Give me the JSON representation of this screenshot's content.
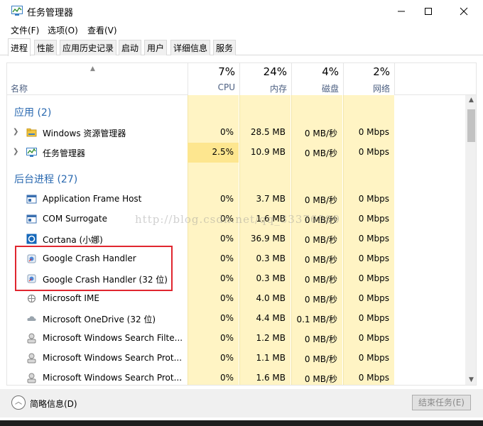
{
  "window": {
    "title": "任务管理器",
    "controls": {
      "minimize": "—",
      "maximize": "☐",
      "close": "✕"
    }
  },
  "menu": [
    "文件(F)",
    "选项(O)",
    "查看(V)"
  ],
  "tabs": [
    {
      "label": "进程",
      "active": true
    },
    {
      "label": "性能"
    },
    {
      "label": "应用历史记录"
    },
    {
      "label": "启动"
    },
    {
      "label": "用户"
    },
    {
      "label": "详细信息"
    },
    {
      "label": "服务"
    }
  ],
  "columns": {
    "name": "名称",
    "cpu": {
      "pct": "7%",
      "label": "CPU"
    },
    "mem": {
      "pct": "24%",
      "label": "内存"
    },
    "disk": {
      "pct": "4%",
      "label": "磁盘"
    },
    "net": {
      "pct": "2%",
      "label": "网络"
    }
  },
  "groups": {
    "apps": "应用 (2)",
    "background": "后台进程 (27)"
  },
  "apps": [
    {
      "name": "Windows 资源管理器",
      "cpu": "0%",
      "mem": "28.5 MB",
      "disk": "0 MB/秒",
      "net": "0 Mbps",
      "icon": "folder-icon"
    },
    {
      "name": "任务管理器",
      "cpu": "2.5%",
      "mem": "10.9 MB",
      "disk": "0 MB/秒",
      "net": "0 Mbps",
      "icon": "task-manager-icon"
    }
  ],
  "background": [
    {
      "name": "Application Frame Host",
      "cpu": "0%",
      "mem": "3.7 MB",
      "disk": "0 MB/秒",
      "net": "0 Mbps",
      "icon": "window-app-icon"
    },
    {
      "name": "COM Surrogate",
      "cpu": "0%",
      "mem": "1.6 MB",
      "disk": "0 MB/秒",
      "net": "0 Mbps",
      "icon": "window-app-icon"
    },
    {
      "name": "Cortana (小娜)",
      "cpu": "0%",
      "mem": "36.9 MB",
      "disk": "0 MB/秒",
      "net": "0 Mbps",
      "icon": "cortana-icon"
    },
    {
      "name": "Google Crash Handler",
      "cpu": "0%",
      "mem": "0.3 MB",
      "disk": "0 MB/秒",
      "net": "0 Mbps",
      "icon": "google-update-icon"
    },
    {
      "name": "Google Crash Handler (32 位)",
      "cpu": "0%",
      "mem": "0.3 MB",
      "disk": "0 MB/秒",
      "net": "0 Mbps",
      "icon": "google-update-icon"
    },
    {
      "name": "Microsoft IME",
      "cpu": "0%",
      "mem": "4.0 MB",
      "disk": "0 MB/秒",
      "net": "0 Mbps",
      "icon": "ime-icon"
    },
    {
      "name": "Microsoft OneDrive (32 位)",
      "cpu": "0%",
      "mem": "4.4 MB",
      "disk": "0.1 MB/秒",
      "net": "0 Mbps",
      "icon": "onedrive-icon"
    },
    {
      "name": "Microsoft Windows Search Filte...",
      "cpu": "0%",
      "mem": "1.2 MB",
      "disk": "0 MB/秒",
      "net": "0 Mbps",
      "icon": "search-service-icon"
    },
    {
      "name": "Microsoft Windows Search Prot...",
      "cpu": "0%",
      "mem": "1.1 MB",
      "disk": "0 MB/秒",
      "net": "0 Mbps",
      "icon": "search-service-icon"
    },
    {
      "name": "Microsoft Windows Search Prot...",
      "cpu": "0%",
      "mem": "1.6 MB",
      "disk": "0 MB/秒",
      "net": "0 Mbps",
      "icon": "search-service-icon"
    }
  ],
  "watermark": "http://blog.csdn.net/qq_33376599",
  "footer": {
    "fewer_details": "简略信息(D)",
    "end_task": "结束任务(E)"
  },
  "colors": {
    "accent": "#2a69b0",
    "column_band": "#fff4c4",
    "highlight_box": "#e0262f"
  }
}
